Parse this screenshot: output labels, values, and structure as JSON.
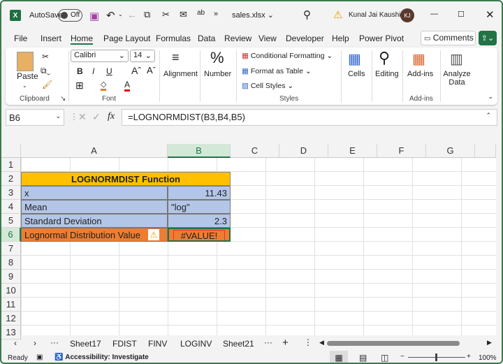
{
  "titlebar": {
    "autosave": "AutoSave",
    "autosave_state": "Off",
    "filename": "sales.xlsx",
    "user": "Kunal Jai Kaushik",
    "initials": "KJ"
  },
  "menu": {
    "tabs": [
      "File",
      "Insert",
      "Home",
      "Page Layout",
      "Formulas",
      "Data",
      "Review",
      "View",
      "Developer",
      "Help",
      "Power Pivot"
    ],
    "active": "Home",
    "comments": "Comments"
  },
  "ribbon": {
    "paste": "Paste",
    "clipboard": "Clipboard",
    "font_name": "Calibri",
    "font_size": "14",
    "bold": "B",
    "italic": "I",
    "underline": "U",
    "font": "Font",
    "alignment": "Alignment",
    "number": "Number",
    "conditional_formatting": "Conditional Formatting",
    "format_as_table": "Format as Table",
    "cell_styles": "Cell Styles",
    "styles": "Styles",
    "cells": "Cells",
    "editing": "Editing",
    "addins": "Add-ins",
    "addins_group": "Add-ins",
    "analyze_data": "Analyze Data"
  },
  "formula_bar": {
    "name_box": "B6",
    "fx": "fx",
    "formula": "=LOGNORMDIST(B3,B4,B5)"
  },
  "columns": [
    "A",
    "B",
    "C",
    "D",
    "E",
    "F",
    "G"
  ],
  "rows": [
    "1",
    "2",
    "3",
    "4",
    "5",
    "6",
    "7",
    "8",
    "9",
    "10",
    "11",
    "12",
    "13"
  ],
  "table": {
    "title": "LOGNORMDIST Function",
    "rows": [
      {
        "label": "x",
        "value": "11.43"
      },
      {
        "label": "Mean",
        "value": "\"log\""
      },
      {
        "label": "Standard Deviation",
        "value": "2.3"
      },
      {
        "label": "Lognormal Distribution Value",
        "value": "#VALUE!"
      }
    ]
  },
  "colors": {
    "header": "#FFC000",
    "input": "#B4C6E7",
    "result": "#ED7D31",
    "accent": "#217346"
  },
  "sheet_tabs": [
    "Sheet17",
    "FDIST",
    "FINV",
    "LOGINV",
    "Sheet21"
  ],
  "status": {
    "ready": "Ready",
    "accessibility": "Accessibility: Investigate",
    "zoom": "100%"
  }
}
